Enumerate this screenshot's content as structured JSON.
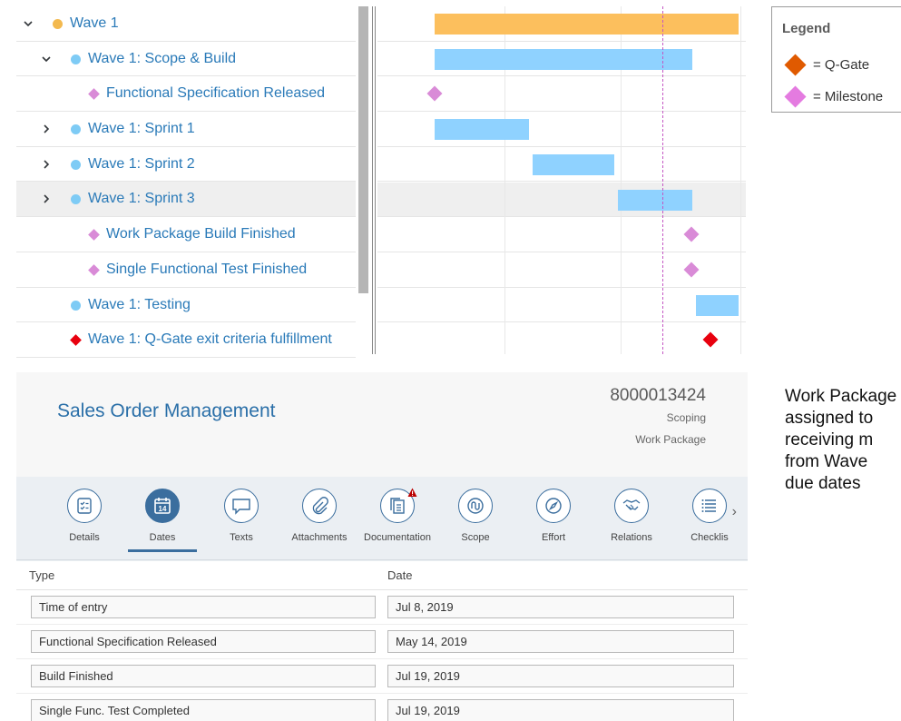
{
  "gantt": {
    "rows": [
      {
        "label": "Wave 1",
        "level": 0,
        "expander": "expanded",
        "marker": "dot",
        "color": "#f3b94f",
        "bar": {
          "kind": "bar",
          "color": "#fcbf5d"
        }
      },
      {
        "label": "Wave 1: Scope & Build",
        "level": 1,
        "expander": "expanded",
        "marker": "dot",
        "color": "#7ecbf5",
        "bar": {
          "kind": "bar",
          "color": "#8fd2ff"
        }
      },
      {
        "label": "Functional Specification Released",
        "level": 2,
        "expander": "none",
        "marker": "diamond",
        "color": "#d98bd7",
        "bar": {
          "kind": "milestone",
          "color": "#d98bd7"
        }
      },
      {
        "label": "Wave 1: Sprint 1",
        "level": 1,
        "expander": "collapsed",
        "marker": "dot",
        "color": "#7ecbf5",
        "bar": {
          "kind": "bar",
          "color": "#8fd2ff"
        }
      },
      {
        "label": "Wave 1: Sprint 2",
        "level": 1,
        "expander": "collapsed",
        "marker": "dot",
        "color": "#7ecbf5",
        "bar": {
          "kind": "bar",
          "color": "#8fd2ff"
        }
      },
      {
        "label": "Wave 1: Sprint 3",
        "level": 1,
        "expander": "collapsed",
        "marker": "dot",
        "color": "#7ecbf5",
        "bar": {
          "kind": "bar",
          "color": "#8fd2ff"
        },
        "selected": true
      },
      {
        "label": "Work Package Build Finished",
        "level": 2,
        "expander": "none",
        "marker": "diamond",
        "color": "#d98bd7",
        "bar": {
          "kind": "milestone",
          "color": "#d98bd7"
        }
      },
      {
        "label": "Single Functional Test Finished",
        "level": 2,
        "expander": "none",
        "marker": "diamond",
        "color": "#d98bd7",
        "bar": {
          "kind": "milestone",
          "color": "#d98bd7"
        }
      },
      {
        "label": "Wave 1: Testing",
        "level": 1,
        "expander": "none",
        "marker": "dot",
        "color": "#7ecbf5",
        "bar": {
          "kind": "bar",
          "color": "#8fd2ff"
        }
      },
      {
        "label": "Wave 1: Q-Gate exit criteria fulfillment",
        "level": 1,
        "expander": "none",
        "marker": "diamond",
        "color": "#e8000e",
        "bar": {
          "kind": "qgate",
          "color": "#e8000e"
        }
      }
    ]
  },
  "legend": {
    "title": "Legend",
    "items": [
      {
        "label": "= Q-Gate",
        "color": "#e05a00"
      },
      {
        "label": "= Milestone",
        "color": "#e47be0"
      }
    ]
  },
  "note": {
    "lines": [
      "Work Package",
      "assigned to",
      "receiving m",
      "from Wave",
      "due dates"
    ]
  },
  "object": {
    "title": "Sales Order Management",
    "number": "8000013424",
    "status": "Scoping",
    "type": "Work Package"
  },
  "tabs": [
    {
      "label": "Details",
      "icon": "checklist-icon"
    },
    {
      "label": "Dates",
      "icon": "calendar-icon",
      "day": "14",
      "active": true
    },
    {
      "label": "Texts",
      "icon": "speech-bubble-icon"
    },
    {
      "label": "Attachments",
      "icon": "paperclip-icon"
    },
    {
      "label": "Documentation",
      "icon": "documents-icon",
      "warning": true
    },
    {
      "label": "Scope",
      "icon": "scope-icon"
    },
    {
      "label": "Effort",
      "icon": "compass-icon"
    },
    {
      "label": "Relations",
      "icon": "handshake-icon"
    },
    {
      "label": "Checklis",
      "icon": "list-icon"
    }
  ],
  "table": {
    "headers": {
      "type": "Type",
      "date": "Date"
    },
    "rows": [
      {
        "type": "Time of entry",
        "date": "Jul 8, 2019"
      },
      {
        "type": "Functional Specification Released",
        "date": "May 14, 2019"
      },
      {
        "type": "Build Finished",
        "date": "Jul 19, 2019"
      },
      {
        "type": "Single Func. Test Completed",
        "date": "Jul 19, 2019"
      }
    ]
  }
}
